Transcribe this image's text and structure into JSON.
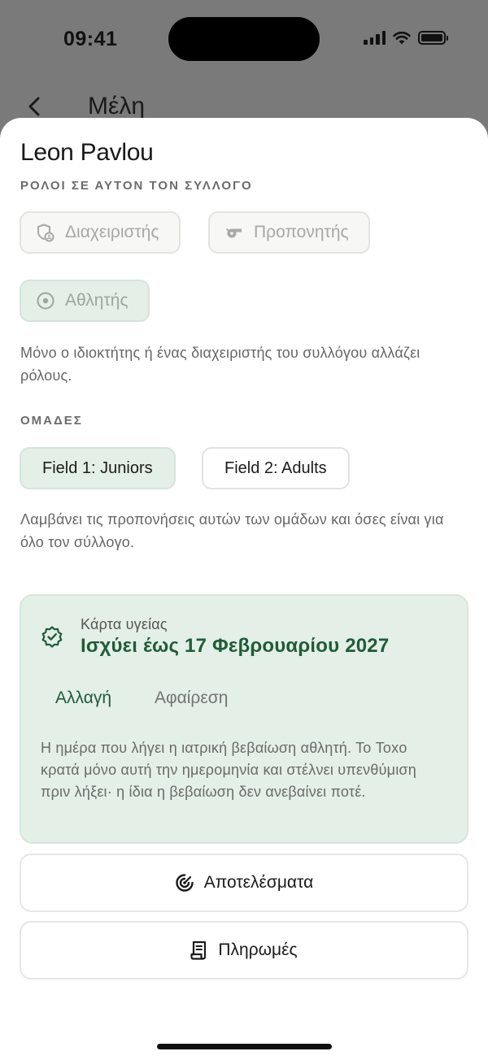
{
  "status_bar": {
    "time": "09:41"
  },
  "background": {
    "title": "Μέλη"
  },
  "member": {
    "name": "Leon Pavlou"
  },
  "roles": {
    "section_label": "ΡΟΛΟΙ ΣΕ ΑΥΤΟΝ ΤΟΝ ΣΥΛΛΟΓΟ",
    "items": [
      {
        "label": "Διαχειριστής",
        "icon": "shield-user-icon",
        "selected": false
      },
      {
        "label": "Προπονητής",
        "icon": "whistle-icon",
        "selected": false
      },
      {
        "label": "Αθλητής",
        "icon": "target-icon",
        "selected": true
      }
    ],
    "note": "Μόνο ο ιδιοκτήτης ή ένας διαχειριστής του συλλόγου αλλάζει ρόλους."
  },
  "teams": {
    "section_label": "ΟΜΑΔΕΣ",
    "items": [
      {
        "label": "Field 1: Juniors",
        "selected": true
      },
      {
        "label": "Field 2: Adults",
        "selected": false
      }
    ],
    "note": "Λαμβάνει τις προπονήσεις αυτών των ομάδων και όσες είναι για όλο τον σύλλογο."
  },
  "health_card": {
    "label": "Κάρτα υγείας",
    "value": "Ισχύει έως 17 Φεβρουαρίου 2027",
    "change_label": "Αλλαγή",
    "remove_label": "Αφαίρεση",
    "note": "Η ημέρα που λήγει η ιατρική βεβαίωση αθλητή. Το Toxo κρατά μόνο αυτή την ημερομηνία και στέλνει υπενθύμιση πριν λήξει· η ίδια η βεβαίωση δεν ανεβαίνει ποτέ.",
    "icon": "badge-check-icon"
  },
  "actions": [
    {
      "label": "Αποτελέσματα",
      "icon": "target-results-icon"
    },
    {
      "label": "Πληρωμές",
      "icon": "receipt-icon"
    }
  ],
  "colors": {
    "accent": "#1f5c38",
    "selected_bg": "#e3efe7"
  }
}
